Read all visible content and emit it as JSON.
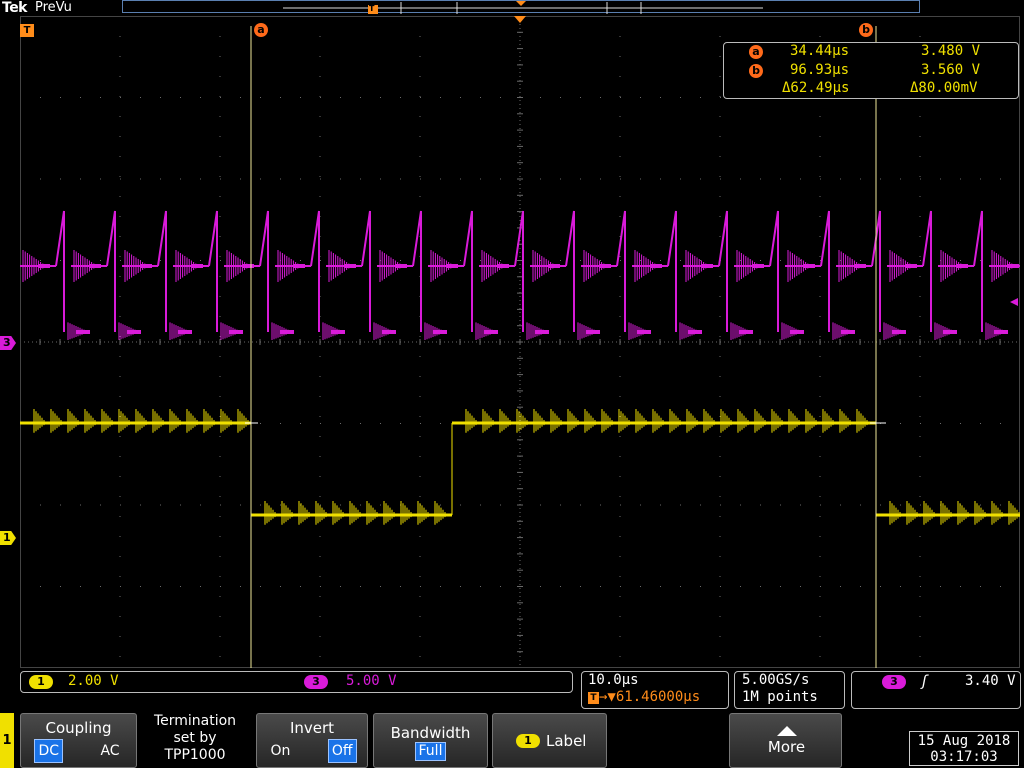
{
  "header": {
    "brand": "Tek",
    "mode": "PreVu",
    "trigger_badge": "T"
  },
  "cursors": {
    "a": {
      "label": "a",
      "time": "34.44µs",
      "voltage": "3.480 V"
    },
    "b": {
      "label": "b",
      "time": "96.93µs",
      "voltage": "3.560 V"
    },
    "delta_time": "Δ62.49µs",
    "delta_voltage": "Δ80.00mV"
  },
  "channels": {
    "ch1": {
      "label": "1",
      "scale": "2.00 V",
      "color": "#f0e000"
    },
    "ch3": {
      "label": "3",
      "scale": "5.00 V",
      "color": "#d91bd9"
    }
  },
  "timebase": {
    "scale": "10.0µs",
    "trigger_marker": "T",
    "trigger_delay": "→▼61.46000µs"
  },
  "acquisition": {
    "sample_rate": "5.00GS/s",
    "record_length": "1M points"
  },
  "trigger": {
    "source": "3",
    "slope_icon": "ʃ",
    "level": "3.40 V"
  },
  "menu": {
    "channel": "1",
    "coupling": {
      "title": "Coupling",
      "options": [
        "DC",
        "AC"
      ],
      "selected": "DC"
    },
    "termination": {
      "line1": "Termination",
      "line2": "set by",
      "line3": "TPP1000"
    },
    "invert": {
      "title": "Invert",
      "options": [
        "On",
        "Off"
      ],
      "selected": "Off"
    },
    "bandwidth": {
      "title": "Bandwidth",
      "value": "Full"
    },
    "label": {
      "channel": "1",
      "text": "Label"
    },
    "more": {
      "text": "More"
    }
  },
  "datetime": {
    "date": "15 Aug 2018",
    "time": "03:17:03"
  },
  "colors": {
    "cursor": "#ff6a1a",
    "graticule": "#6a6a6a",
    "accent": "#1a73e8"
  }
}
